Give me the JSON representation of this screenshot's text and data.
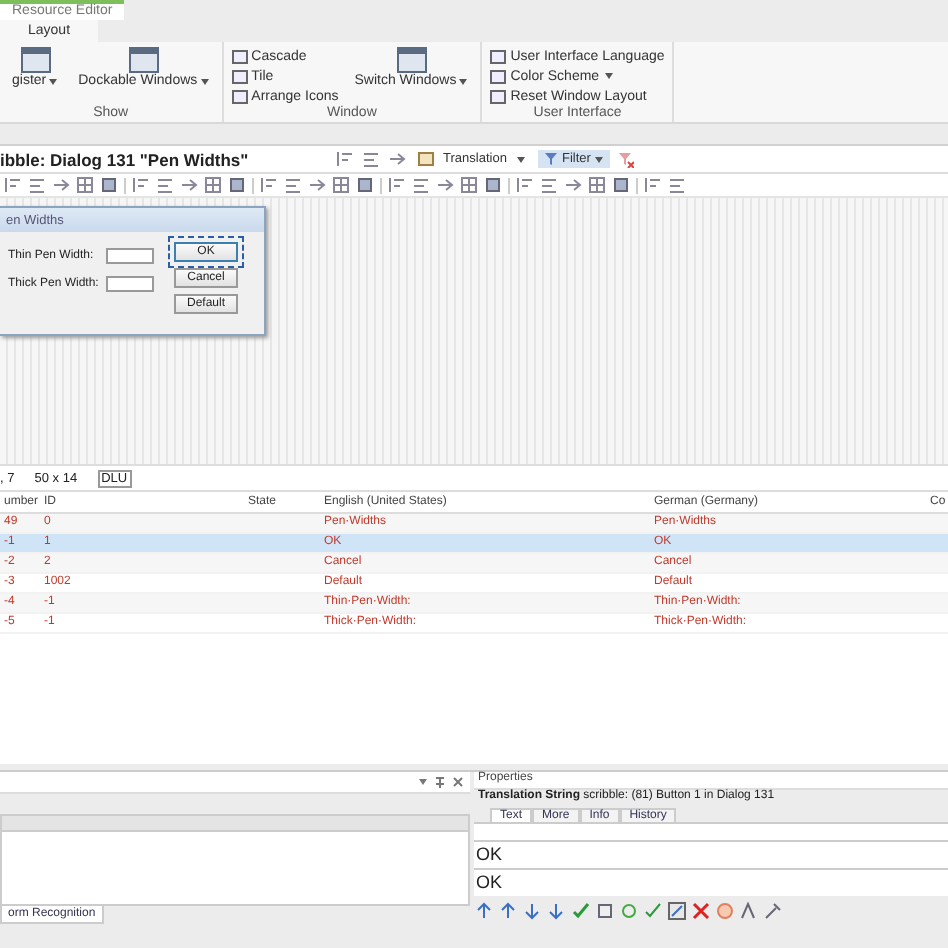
{
  "app_tabs": [
    {
      "label": "Resource Editor",
      "selected": true
    }
  ],
  "ribbon_tabs": [
    {
      "label": "Layout",
      "selected": true
    }
  ],
  "ribbon_groups": [
    {
      "title": "Show",
      "items": [
        {
          "kind": "large",
          "label": "gister",
          "dropdown": true
        },
        {
          "kind": "large",
          "label": "Dockable Windows",
          "dropdown": true
        }
      ]
    },
    {
      "title": "Window",
      "items": [
        {
          "kind": "small",
          "label": "Cascade",
          "dropdown": false
        },
        {
          "kind": "small",
          "label": "Tile",
          "dropdown": false
        },
        {
          "kind": "small",
          "label": "Arrange Icons",
          "dropdown": false
        },
        {
          "kind": "large",
          "label": "Switch Windows",
          "dropdown": true
        }
      ]
    },
    {
      "title": "User Interface",
      "items": [
        {
          "kind": "small",
          "label": "User Interface Language",
          "dropdown": false
        },
        {
          "kind": "small",
          "label": "Color Scheme",
          "dropdown": true
        },
        {
          "kind": "small",
          "label": "Reset Window Layout",
          "dropdown": false
        }
      ]
    }
  ],
  "editor": {
    "title": "ibble: Dialog 131 \"Pen Widths\"",
    "view_mode": "Translation",
    "filter": {
      "label": "Filter",
      "selected": true
    }
  },
  "dialog": {
    "title": "en Widths",
    "fields": [
      {
        "label": "Thin Pen Width:"
      },
      {
        "label": "Thick Pen Width:"
      }
    ],
    "buttons": [
      {
        "label": "OK",
        "selected": true
      },
      {
        "label": "Cancel",
        "selected": false
      },
      {
        "label": "Default",
        "selected": false
      }
    ]
  },
  "position_bar": {
    "position": ", 7",
    "size": "50 x 14",
    "unit": "DLU"
  },
  "table": {
    "columns": [
      "umber",
      "ID",
      "State",
      "English (United States)",
      "German (Germany)",
      "Co"
    ],
    "rows": [
      {
        "number": "49",
        "id": "0",
        "english": "Pen·Widths",
        "german": "Pen·Widths",
        "selected": false
      },
      {
        "number": "-1",
        "id": "1",
        "english": "OK",
        "german": "OK",
        "selected": true
      },
      {
        "number": "-2",
        "id": "2",
        "english": "Cancel",
        "german": "Cancel",
        "selected": false
      },
      {
        "number": "-3",
        "id": "1002",
        "english": "Default",
        "german": "Default",
        "selected": false
      },
      {
        "number": "-4",
        "id": "-1",
        "english": "Thin·Pen·Width:",
        "german": "Thin·Pen·Width:",
        "selected": false
      },
      {
        "number": "-5",
        "id": "-1",
        "english": "Thick·Pen·Width:",
        "german": "Thick·Pen·Width:",
        "selected": false
      }
    ]
  },
  "bottom_tabs": [
    {
      "label": "orm Recognition",
      "selected": true
    }
  ],
  "properties": {
    "title": "Properties",
    "info": "**Translation String** scribble: (81) Button 1 in Dialog 131",
    "tabs": [
      {
        "label": "Text",
        "selected": true
      },
      {
        "label": "More",
        "selected": false
      },
      {
        "label": "Info",
        "selected": false
      },
      {
        "label": "History",
        "selected": false
      }
    ],
    "source_text": "OK",
    "translation_text": "OK"
  }
}
